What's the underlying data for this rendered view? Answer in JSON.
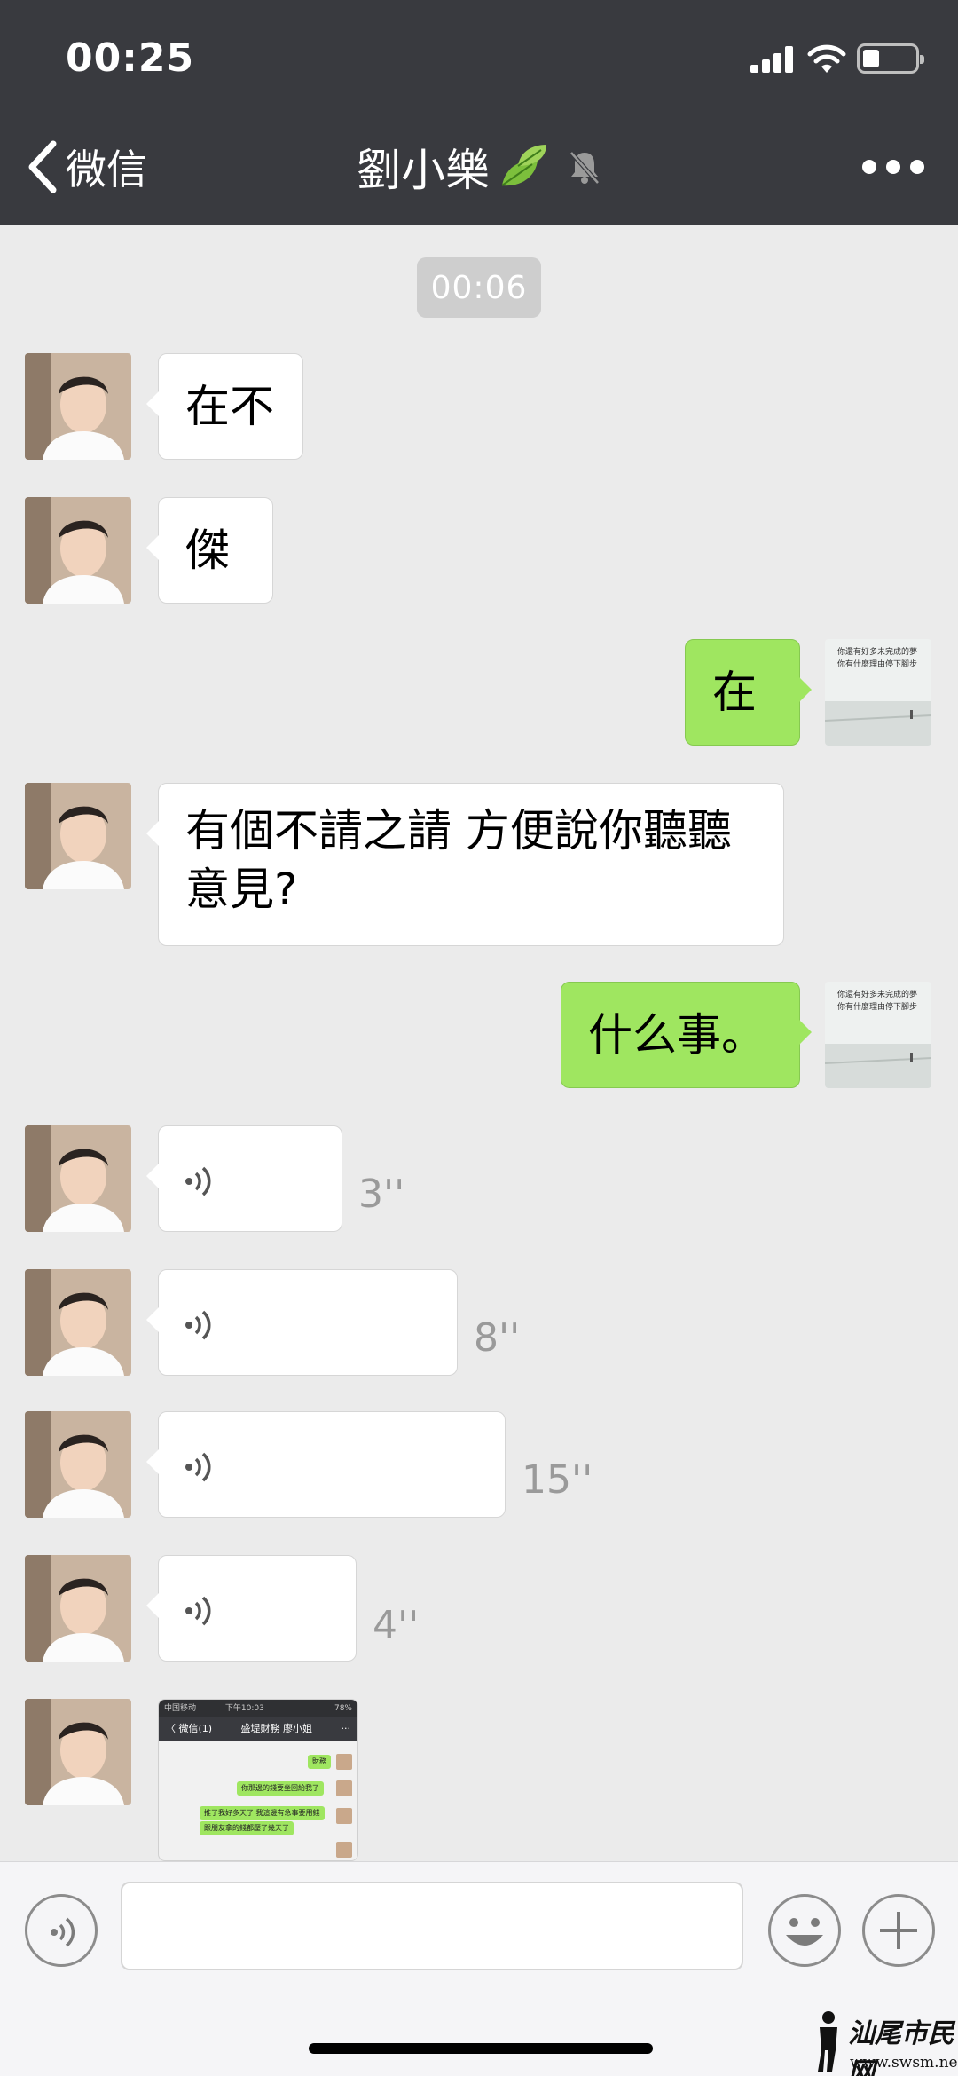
{
  "status_bar": {
    "time": "00:25"
  },
  "nav": {
    "back_label": "微信",
    "title": "劉小樂"
  },
  "chat": {
    "timestamp": "00:06",
    "text_in_1": "在不",
    "text_in_2": "傑",
    "text_out_1": "在",
    "text_in_3_line1": "有個不請之請 方便說你聽聽",
    "text_in_3_line2": "意見?",
    "text_out_2": "什么事。",
    "voice_1_duration": "3''",
    "voice_2_duration": "8''",
    "voice_3_duration": "15''",
    "voice_4_duration": "4''",
    "my_avatar_caption_1": "你還有好多未完成的夢",
    "my_avatar_caption_2": "你有什麼理由停下腳步",
    "screenshot": {
      "status": "中国移动",
      "time": "下午10:03",
      "battery": "78%",
      "back": "〈 微信(1)",
      "title": "盛堤財務 廖小姐",
      "msg1": "財務",
      "msg2": "你那邊的錢要坐回給我了",
      "msg3": "推了我好多天了 我這邊有急事要用錢",
      "msg4": "跟朋友拿的錢都壓了幾天了"
    }
  },
  "watermark": {
    "site_name": "汕尾市民网",
    "url": "www.swsm.net"
  },
  "colors": {
    "nav_bg": "#393a3f",
    "chat_bg": "#ebebeb",
    "outgoing_bubble": "#9fe660",
    "incoming_bubble": "#ffffff"
  }
}
